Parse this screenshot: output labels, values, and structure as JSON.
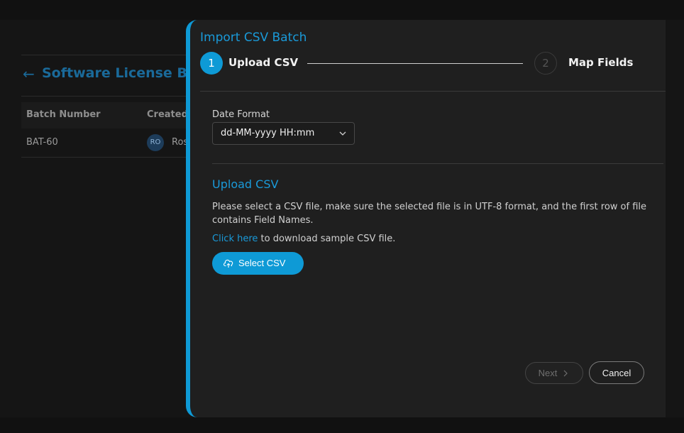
{
  "background": {
    "page_title": "Software License Bat",
    "table": {
      "headers": [
        "Batch Number",
        "Created"
      ],
      "rows": [
        {
          "batch_number": "BAT-60",
          "avatar_initials": "RO",
          "created_by": "Ros"
        }
      ]
    }
  },
  "drawer": {
    "title": "Import CSV Batch",
    "steps": [
      {
        "number": "1",
        "label": "Upload CSV",
        "active": true
      },
      {
        "number": "2",
        "label": "Map Fields",
        "active": false
      }
    ],
    "date_format": {
      "label": "Date Format",
      "value": "dd-MM-yyyy HH:mm"
    },
    "upload": {
      "title": "Upload CSV",
      "description": "Please select a CSV file, make sure the selected file is in UTF-8 format, and the first row of file contains Field Names.",
      "link_text": "Click here",
      "link_suffix": " to download sample CSV file.",
      "button_label": "Select CSV"
    },
    "footer": {
      "next_label": "Next",
      "cancel_label": "Cancel"
    }
  },
  "colors": {
    "accent": "#0e9ad6",
    "accent_text": "#1a9ad9"
  }
}
